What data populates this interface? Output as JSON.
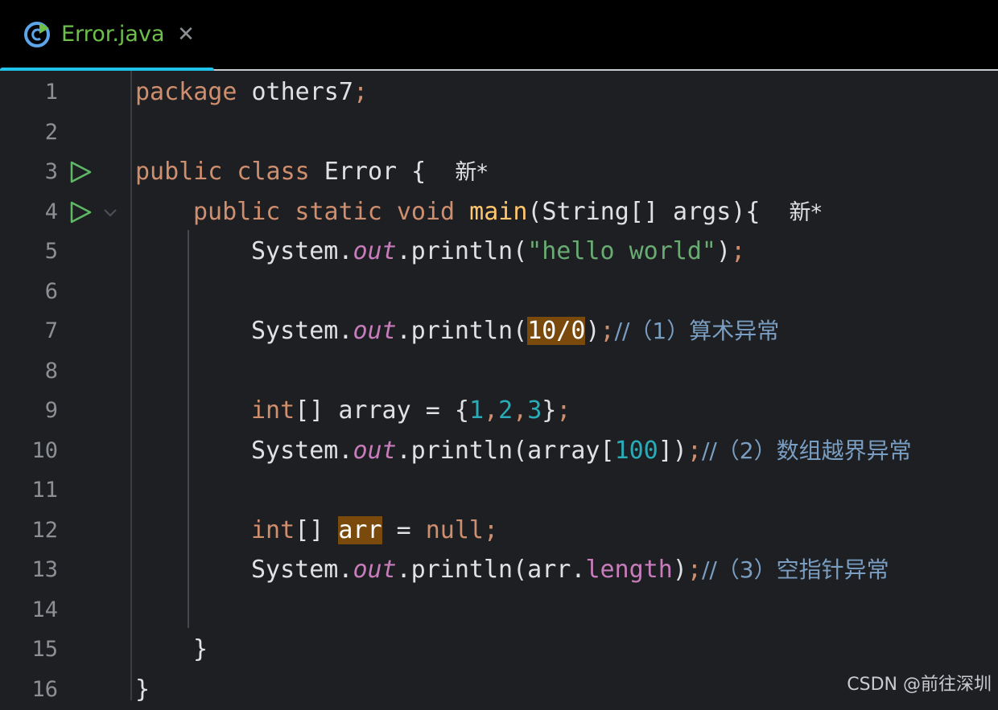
{
  "tab": {
    "label": "Error.java",
    "close_glyph": "✕",
    "icon": "java-class-icon"
  },
  "editor": {
    "line_numbers": [
      "1",
      "2",
      "3",
      "4",
      "5",
      "6",
      "7",
      "8",
      "9",
      "10",
      "11",
      "12",
      "13",
      "14",
      "15",
      "16"
    ],
    "lines": {
      "l1_kw": "package",
      "l1_rest": " others7",
      "l1_semi": ";",
      "l3_kw": "public class",
      "l3_rest": " Error {",
      "l3_new": "新*",
      "l4_kw": "public static void",
      "l4_fn": "main",
      "l4_rest": "(String[] args){",
      "l4_new": "新*",
      "l5_a": "System.",
      "l5_field": "out",
      "l5_b": ".println(",
      "l5_str": "\"hello world\"",
      "l5_c": ")",
      "l5_semi": ";",
      "l7_a": "System.",
      "l7_field": "out",
      "l7_b": ".println(",
      "l7_hl": "10/0",
      "l7_c": ")",
      "l7_semi": ";",
      "l7_cmt": "//（1）算术异常",
      "l9_kw": "int",
      "l9_a": "[] array = {",
      "l9_n1": "1",
      "l9_comma1": ",",
      "l9_n2": "2",
      "l9_comma2": ",",
      "l9_n3": "3",
      "l9_b": "}",
      "l9_semi": ";",
      "l10_a": "System.",
      "l10_field": "out",
      "l10_b": ".println(array[",
      "l10_num": "100",
      "l10_c": "])",
      "l10_semi": ";",
      "l10_cmt": "//（2）数组越界异常",
      "l12_kw": "int",
      "l12_a": "[] ",
      "l12_hl": "arr",
      "l12_b": " = ",
      "l12_null": "null",
      "l12_semi": ";",
      "l13_a": "System.",
      "l13_field": "out",
      "l13_b": ".println(arr.",
      "l13_prop": "length",
      "l13_c": ")",
      "l13_semi": ";",
      "l13_cmt": "//（3）空指针异常",
      "l15": "}",
      "l16": "}"
    }
  },
  "watermark": "CSDN @前往深圳",
  "colors": {
    "tab_label": "#6cc04a",
    "tab_underline": "#20c3ea",
    "keyword": "#cf8e6d",
    "string": "#6aab73",
    "number": "#2aacb8",
    "field": "#c77dbb",
    "comment": "#7a9ec2",
    "highlight": "#7a4a0c",
    "run_icon": "#5fb865"
  }
}
